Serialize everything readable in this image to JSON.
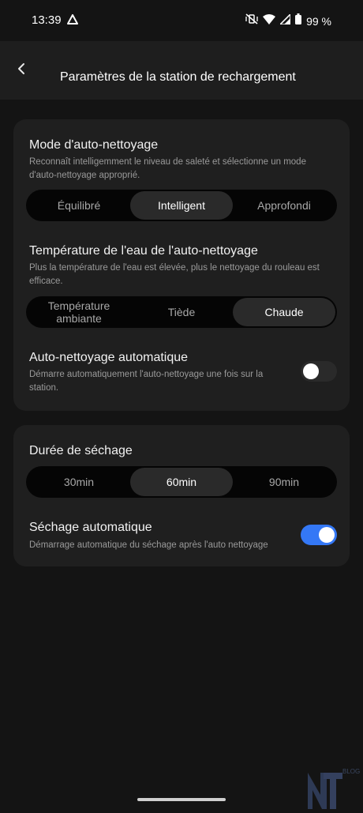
{
  "status": {
    "time": "13:39",
    "battery": "99 %"
  },
  "header": {
    "title": "Paramètres de la station de rechargement"
  },
  "self_clean_mode": {
    "title": "Mode d'auto-nettoyage",
    "description": "Reconnaît intelligemment le niveau de saleté et sélectionne un mode d'auto-nettoyage approprié.",
    "options": [
      "Équilibré",
      "Intelligent",
      "Approfondi"
    ],
    "selected": "Intelligent"
  },
  "water_temperature": {
    "title": "Température de l'eau de l'auto-nettoyage",
    "description": "Plus la température de l'eau est élevée, plus le nettoyage du rouleau est efficace.",
    "options": [
      "Température ambiante",
      "Tiède",
      "Chaude"
    ],
    "selected": "Chaude"
  },
  "auto_clean": {
    "title": "Auto-nettoyage automatique",
    "description": "Démarre automatiquement l'auto-nettoyage une fois sur la station.",
    "enabled": false
  },
  "drying_duration": {
    "title": "Durée de séchage",
    "options": [
      "30min",
      "60min",
      "90min"
    ],
    "selected": "60min"
  },
  "auto_drying": {
    "title": "Séchage automatique",
    "description": "Démarrage automatique du séchage après l'auto nettoyage",
    "enabled": true
  },
  "colors": {
    "accent": "#3478f6",
    "background": "#141414",
    "card": "#1f1f1f"
  },
  "watermark": {
    "letters": "NT",
    "tag": "BLOG"
  }
}
